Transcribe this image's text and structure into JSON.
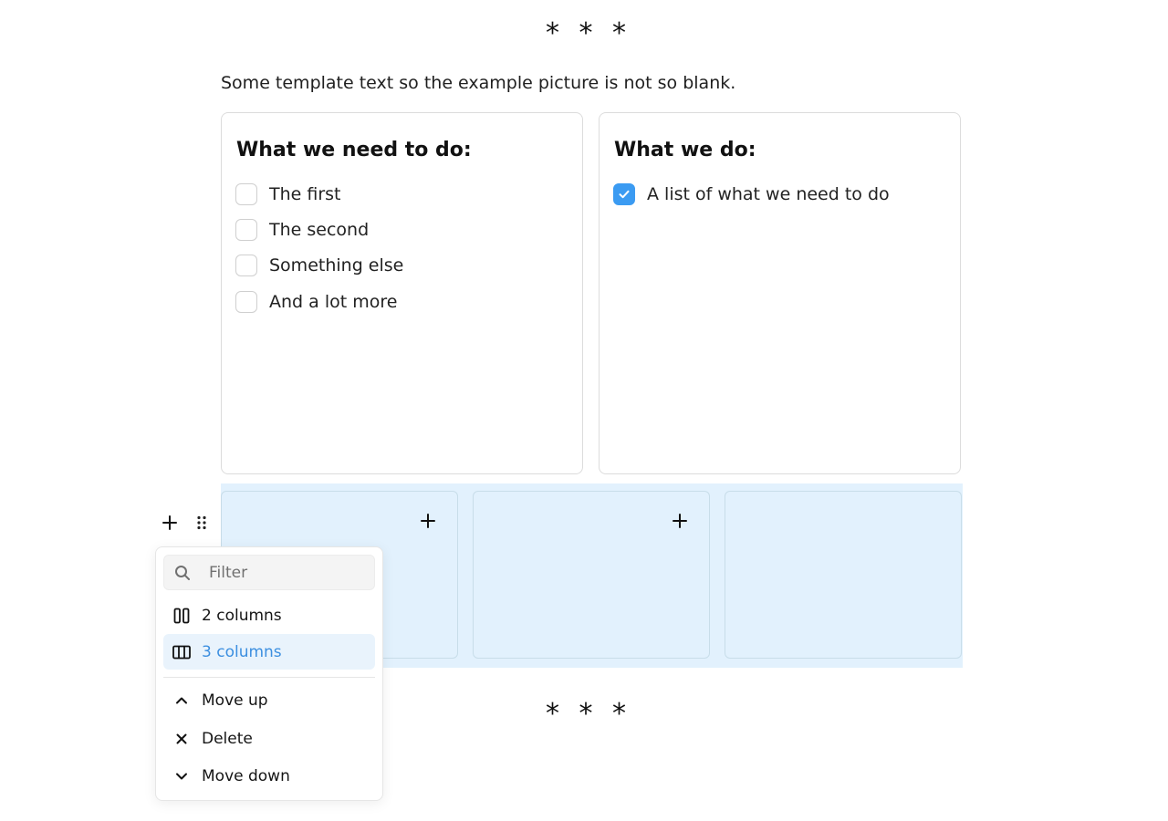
{
  "delimiter_top": "* * *",
  "intro_text": "Some template text so the example picture is not so blank.",
  "card_left": {
    "title": "What we need to do:",
    "items": [
      {
        "label": "The first",
        "checked": false
      },
      {
        "label": "The second",
        "checked": false
      },
      {
        "label": "Something else",
        "checked": false
      },
      {
        "label": "And a lot more",
        "checked": false
      }
    ]
  },
  "card_right": {
    "title": "What we do:",
    "items": [
      {
        "label": "A list of what we need to do",
        "checked": true
      }
    ]
  },
  "columns_block": {
    "column_count": 3,
    "selected_bg": "#e2f1fd"
  },
  "toolbar": {
    "add_icon": "plus-icon",
    "drag_icon": "drag-handle-icon"
  },
  "popover": {
    "filter_placeholder": "Filter",
    "items": [
      {
        "label": "2 columns",
        "icon": "two-columns-icon",
        "active": false
      },
      {
        "label": "3 columns",
        "icon": "three-columns-icon",
        "active": true
      },
      {
        "label": "Move up",
        "icon": "chevron-up-icon",
        "active": false
      },
      {
        "label": "Delete",
        "icon": "close-icon",
        "active": false
      },
      {
        "label": "Move down",
        "icon": "chevron-down-icon",
        "active": false
      }
    ]
  },
  "delimiter_bottom": "* * *",
  "colors": {
    "accent": "#3b9bf2",
    "active_text": "#3c8fe0",
    "active_bg": "#e9f3fc"
  }
}
